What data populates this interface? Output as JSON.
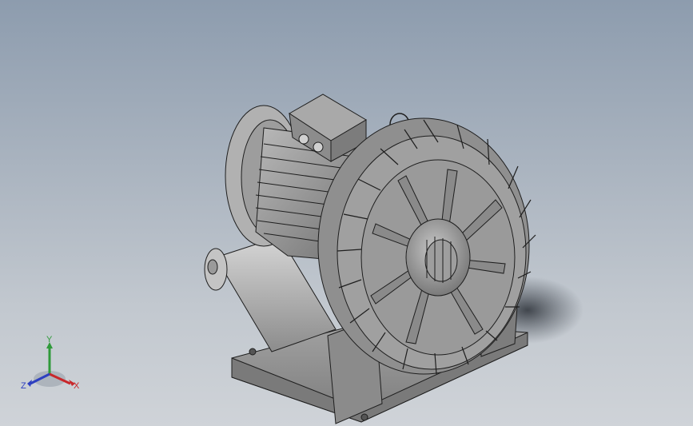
{
  "viewport": {
    "background_top": "#8d9cae",
    "background_bottom": "#cfd3d8"
  },
  "model": {
    "part_color": "#8a8a8a",
    "edge_color": "#1e1e1e"
  },
  "triad": {
    "x_label": "X",
    "y_label": "Y",
    "z_label": "Z",
    "x_color": "#c8272b",
    "y_color": "#2f9a3a",
    "z_color": "#2d3fc0"
  }
}
